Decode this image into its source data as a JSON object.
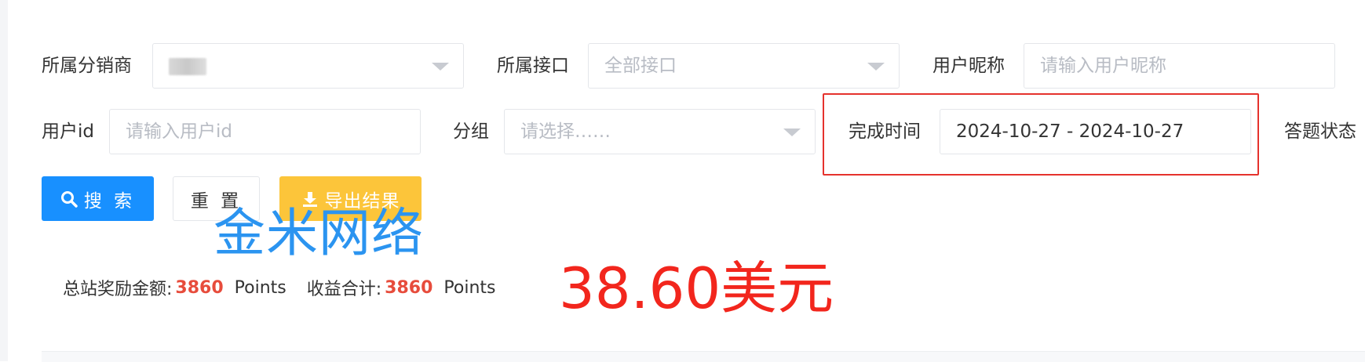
{
  "filters": {
    "distributor": {
      "label": "所属分销商",
      "value": ""
    },
    "interface": {
      "label": "所属接口",
      "placeholder": "全部接口"
    },
    "nickname": {
      "label": "用户昵称",
      "placeholder": "请输入用户昵称"
    },
    "user_id": {
      "label": "用户id",
      "placeholder": "请输入用户id"
    },
    "group": {
      "label": "分组",
      "placeholder": "请选择……"
    },
    "finish_time": {
      "label": "完成时间",
      "value": "2024-10-27 - 2024-10-27"
    },
    "answer_status": {
      "label": "答题状态"
    }
  },
  "buttons": {
    "search": "搜 索",
    "reset": "重 置",
    "export": "导出结果"
  },
  "watermark": "金米网络",
  "stats": {
    "reward_label": "总站奖励金额:",
    "reward_value": "3860",
    "reward_unit": "Points",
    "income_label": "收益合计:",
    "income_value": "3860",
    "income_unit": "Points"
  },
  "money_annotation": "38.60美元",
  "colors": {
    "primary": "#1890ff",
    "warning": "#fcc53a",
    "highlight": "#e5322d",
    "number": "#e74c3c"
  }
}
